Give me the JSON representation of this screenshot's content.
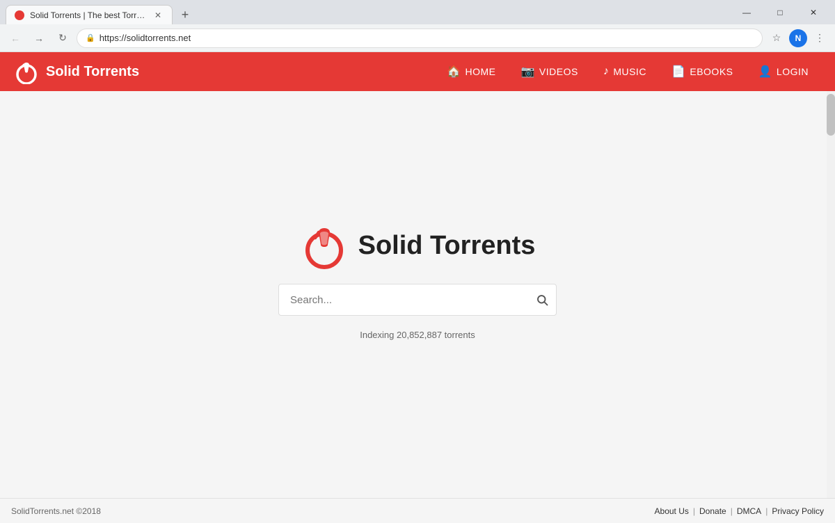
{
  "browser": {
    "tab_title": "Solid Torrents | The best Torrent",
    "url": "https://solidtorrents.net",
    "profile_initial": "N"
  },
  "navbar": {
    "brand": "Solid Torrents",
    "links": [
      {
        "label": "HOME",
        "icon": "🏠"
      },
      {
        "label": "VIDEOS",
        "icon": "📹"
      },
      {
        "label": "MUSIC",
        "icon": "🎵"
      },
      {
        "label": "EBOOKS",
        "icon": "📖"
      },
      {
        "label": "LOGIN",
        "icon": "👤"
      }
    ]
  },
  "hero": {
    "title": "Solid Torrents",
    "search_placeholder": "Search...",
    "indexing_text": "Indexing 20,852,887 torrents"
  },
  "footer": {
    "copyright": "SolidTorrents.net ©2018",
    "links": [
      "About Us",
      "Donate",
      "DMCA",
      "Privacy Policy"
    ]
  },
  "window_controls": {
    "minimize": "—",
    "maximize": "□",
    "close": "✕"
  }
}
